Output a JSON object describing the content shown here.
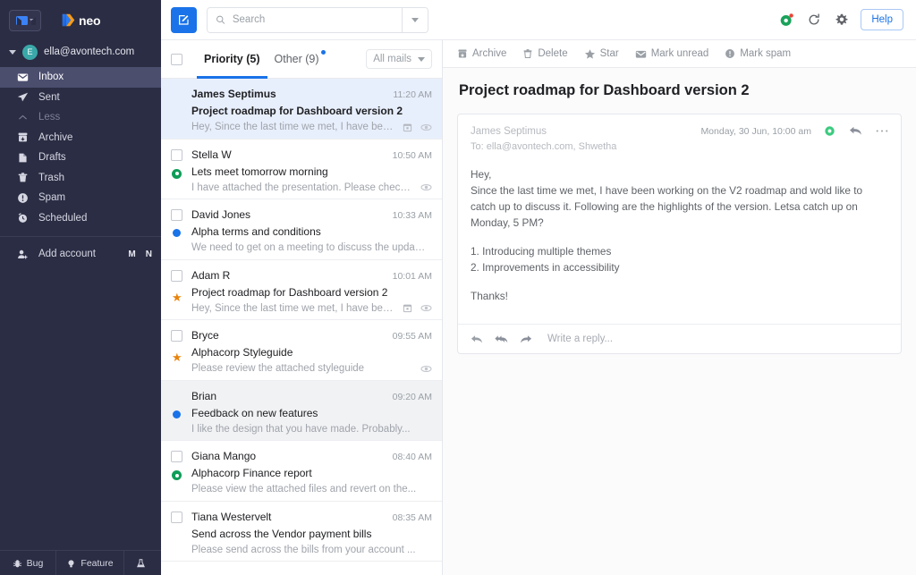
{
  "sidebar": {
    "mail_switcher": "mail-switcher",
    "brand": "neo",
    "account": {
      "initial": "E",
      "email": "ella@avontech.com"
    },
    "nav_items": [
      {
        "label": "Inbox",
        "icon": "inbox-envelope-icon",
        "state": "active"
      },
      {
        "label": "Sent",
        "icon": "send-icon",
        "state": "normal"
      },
      {
        "label": "Less",
        "icon": "chevron-up-icon",
        "state": "muted"
      },
      {
        "label": "Archive",
        "icon": "archive-icon",
        "state": "normal"
      },
      {
        "label": "Drafts",
        "icon": "drafts-icon",
        "state": "normal"
      },
      {
        "label": "Trash",
        "icon": "trash-icon",
        "state": "normal"
      },
      {
        "label": "Spam",
        "icon": "spam-alert-icon",
        "state": "normal"
      },
      {
        "label": "Scheduled",
        "icon": "scheduled-clock-icon",
        "state": "normal"
      }
    ],
    "add_account": {
      "label": "Add account",
      "icon": "add-user-icon",
      "mini_icons": [
        "M",
        "N"
      ]
    },
    "bottom_buttons": [
      {
        "label": "Bug",
        "icon": "bug-icon"
      },
      {
        "label": "Feature",
        "icon": "bulb-icon"
      },
      {
        "label": "",
        "icon": "flask-icon"
      }
    ]
  },
  "topbar": {
    "compose": "compose-icon",
    "search": {
      "value": "",
      "placeholder": "Search",
      "icon": "search-icon"
    },
    "search_dropdown": "chevron-down-icon",
    "icons": [
      "tracking-green-icon",
      "refresh-icon",
      "settings-gear-icon"
    ],
    "help_label": "Help"
  },
  "list_header": {
    "select_all": "select-all-checkbox",
    "tabs": [
      {
        "label": "Priority (5)",
        "active": true,
        "dot": false
      },
      {
        "label": "Other (9)",
        "active": false,
        "dot": true
      }
    ],
    "filter": {
      "label": "All mails",
      "icon": "chevron-down-icon"
    }
  },
  "emails": [
    {
      "sender": "James Septimus",
      "time": "11:20 AM",
      "subject": "Project roadmap for Dashboard version 2",
      "preview": "Hey, Since the last time we met, I have been...",
      "state": "selected",
      "unread": true,
      "marker": "none",
      "checkbox": false,
      "icons": [
        "calendar-icon",
        "tracking-eye-icon"
      ]
    },
    {
      "sender": "Stella W",
      "time": "10:50 AM",
      "subject": "Lets meet tomorrow morning",
      "preview": "I have attached the presentation. Please check and l...",
      "state": "normal",
      "unread": false,
      "marker": "green-ring",
      "checkbox": true,
      "icons": [
        "tracking-eye-icon"
      ]
    },
    {
      "sender": "David Jones",
      "time": "10:33 AM",
      "subject": "Alpha terms and conditions",
      "preview": "We need to get on a meeting to discuss the updated ter...",
      "state": "normal",
      "unread": false,
      "marker": "blue-dot",
      "checkbox": true,
      "icons": []
    },
    {
      "sender": "Adam R",
      "time": "10:01 AM",
      "subject": "Project roadmap for Dashboard version 2",
      "preview": "Hey, Since the last time we met, I have been wor...",
      "state": "normal",
      "unread": false,
      "marker": "star",
      "checkbox": true,
      "icons": [
        "calendar-icon",
        "tracking-eye-icon"
      ]
    },
    {
      "sender": "Bryce",
      "time": "09:55 AM",
      "subject": "Alphacorp Styleguide",
      "preview": "Please review the attached styleguide",
      "state": "normal",
      "unread": false,
      "marker": "star",
      "checkbox": true,
      "icons": [
        "tracking-eye-icon"
      ]
    },
    {
      "sender": "Brian",
      "time": "09:20 AM",
      "subject": "Feedback on new features",
      "preview": "I like the design that you have made. Probably...",
      "state": "hovered",
      "unread": false,
      "marker": "blue-dot",
      "checkbox": false,
      "icons": []
    },
    {
      "sender": "Giana Mango",
      "time": "08:40 AM",
      "subject": "Alphacorp Finance report",
      "preview": "Please view the attached files and revert on the...",
      "state": "normal",
      "unread": false,
      "marker": "green-ring",
      "checkbox": true,
      "icons": []
    },
    {
      "sender": "Tiana Westervelt",
      "time": "08:35 AM",
      "subject": "Send across the Vendor payment bills",
      "preview": "Please send across the bills from your account ...",
      "state": "normal",
      "unread": false,
      "marker": "none",
      "checkbox": true,
      "icons": []
    }
  ],
  "read_toolbar": [
    {
      "label": "Archive",
      "icon": "archive-icon"
    },
    {
      "label": "Delete",
      "icon": "trash-icon"
    },
    {
      "label": "Star",
      "icon": "star-icon"
    },
    {
      "label": "Mark unread",
      "icon": "envelope-icon"
    },
    {
      "label": "Mark spam",
      "icon": "spam-alert-icon"
    }
  ],
  "reading_pane": {
    "title": "Project roadmap for Dashboard version 2",
    "from": "James Septimus",
    "to": "To: ella@avontech.com, Shwetha",
    "date": "Monday, 30 Jun, 10:00 am",
    "actions": [
      "read-receipt-icon",
      "reply-icon",
      "more-options-icon"
    ],
    "body_paragraphs": [
      "Hey,",
      "Since the last time we met, I have been working on the V2 roadmap and wold like to catch up to discuss it. Following are the highlights of the version. Letsa catch up on Monday, 5 PM?",
      "1. Introducing multiple themes",
      "2. Improvements in accessibility",
      "Thanks!"
    ],
    "reply_bar": {
      "placeholder": "Write a reply...",
      "icons": [
        "reply-icon",
        "reply-all-icon",
        "forward-icon"
      ]
    }
  },
  "colors": {
    "sidebar_bg": "#2b2d44",
    "sidebar_active": "#4c4e6e",
    "accent_blue": "#1a73e8",
    "selected_row": "#e8effc",
    "star_orange": "#e8830c",
    "green": "#0f9d58",
    "avatar_teal": "#3aa8a8"
  }
}
